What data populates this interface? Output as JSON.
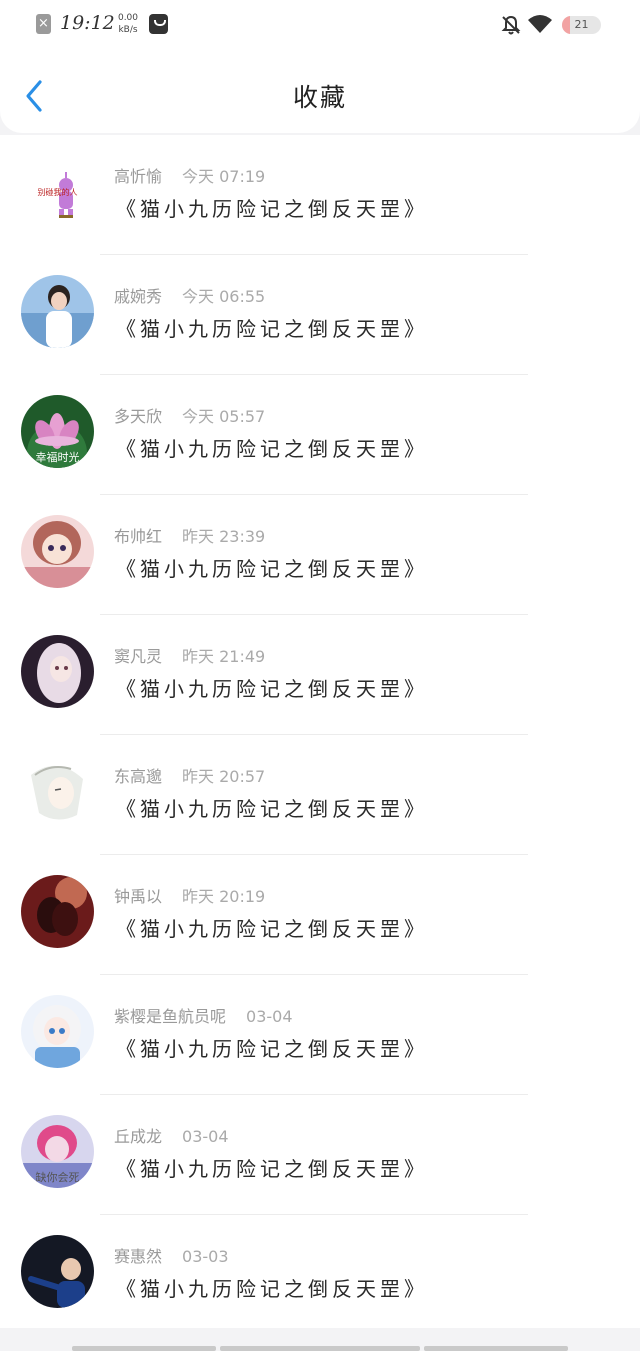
{
  "status_bar": {
    "close_glyph": "×",
    "time": "19:12",
    "speed_value": "0.00",
    "speed_unit": "kB/s",
    "battery": "21",
    "battery_level": 0.21
  },
  "header": {
    "title": "收藏"
  },
  "items": [
    {
      "name": "高忻愉",
      "time": "今天 07:19",
      "book": "《猫小九历险记之倒反天罡》",
      "avatar": "cartoon-pink-rabbit",
      "avatar_caption": "别碰我的人"
    },
    {
      "name": "戚婉秀",
      "time": "今天 06:55",
      "book": "《猫小九历险记之倒反天罡》",
      "avatar": "girl-photo"
    },
    {
      "name": "多天欣",
      "time": "今天 05:57",
      "book": "《猫小九历险记之倒反天罡》",
      "avatar": "lotus-flower",
      "avatar_caption": "幸福时光"
    },
    {
      "name": "布帅红",
      "time": "昨天 23:39",
      "book": "《猫小九历险记之倒反天罡》",
      "avatar": "anime-girl-pink"
    },
    {
      "name": "窦凡灵",
      "time": "昨天 21:49",
      "book": "《猫小九历险记之倒反天罡》",
      "avatar": "anime-girl-dark"
    },
    {
      "name": "东高邈",
      "time": "昨天 20:57",
      "book": "《猫小九历险记之倒反天罡》",
      "avatar": "anime-boy-white"
    },
    {
      "name": "钟禹以",
      "time": "昨天 20:19",
      "book": "《猫小九历险记之倒反天罡》",
      "avatar": "couple-red"
    },
    {
      "name": "紫樱是鱼航员呢",
      "time": "03-04",
      "book": "《猫小九历险记之倒反天罡》",
      "avatar": "anime-girl-blue"
    },
    {
      "name": "丘成龙",
      "time": "03-04",
      "book": "《猫小九历险记之倒反天罡》",
      "avatar": "anime-purple",
      "avatar_caption": "缺你会死"
    },
    {
      "name": "赛惠然",
      "time": "03-03",
      "book": "《猫小九历险记之倒反天罡》",
      "avatar": "man-dark-photo"
    }
  ]
}
